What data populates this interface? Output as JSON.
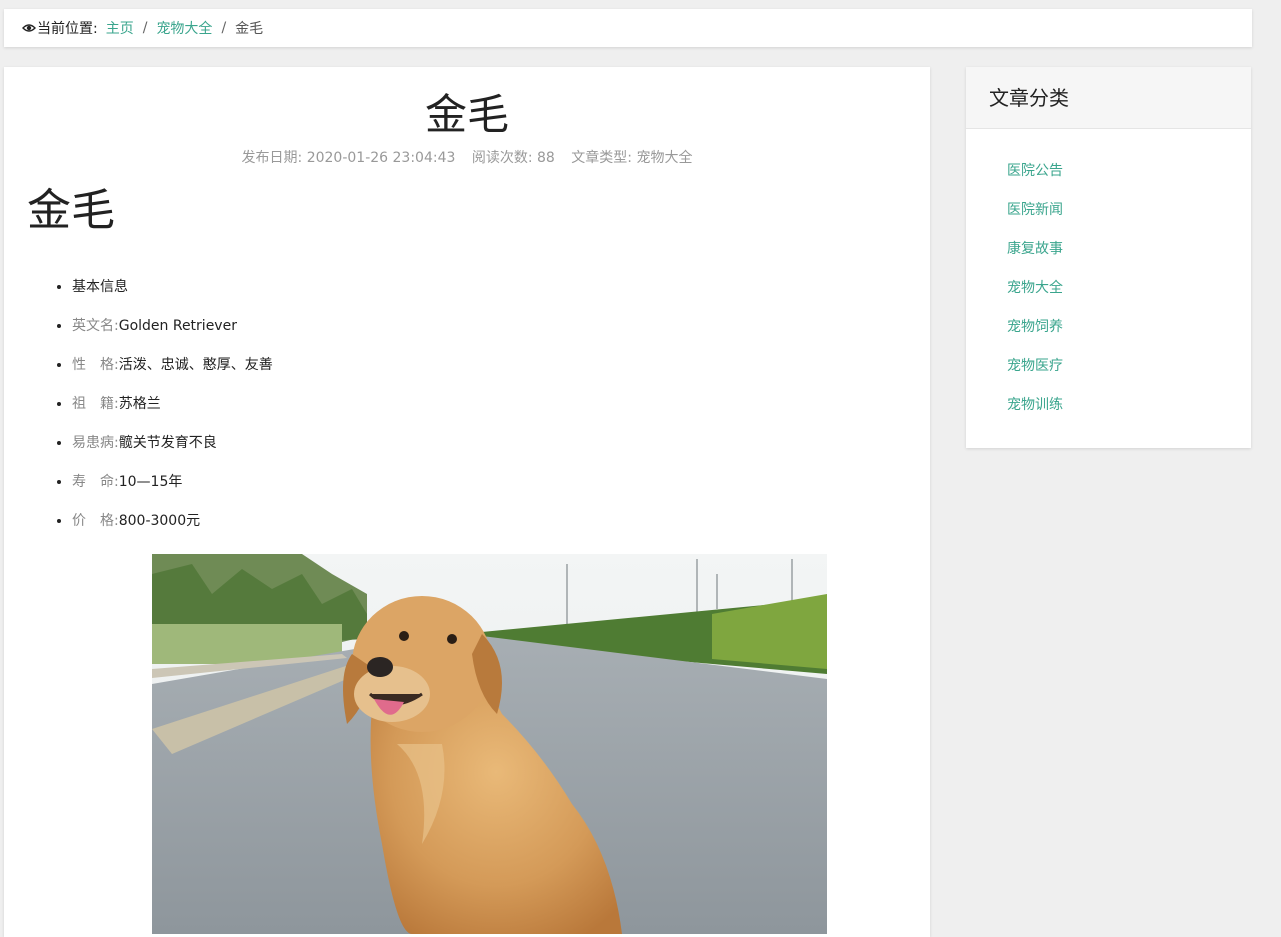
{
  "breadcrumb": {
    "label": "当前位置:",
    "items": [
      {
        "text": "主页"
      },
      {
        "text": "宠物大全"
      }
    ],
    "separator": "/",
    "current": "金毛"
  },
  "article": {
    "title": "金毛",
    "meta": {
      "date": "发布日期: 2020-01-26 23:04:43",
      "views": "阅读次数: 88",
      "type": "文章类型: 宠物大全"
    },
    "content_title": "金毛",
    "info": [
      {
        "key": "",
        "value": "基本信息"
      },
      {
        "key": "英文名:",
        "value": "Golden Retriever"
      },
      {
        "key": "性　格:",
        "value": "活泼、忠诚、憨厚、友善"
      },
      {
        "key": "祖　籍:",
        "value": "苏格兰"
      },
      {
        "key": "易患病:",
        "value": "髋关节发育不良"
      },
      {
        "key": "寿　命:",
        "value": "10—15年"
      },
      {
        "key": "价　格:",
        "value": "800-3000元"
      }
    ]
  },
  "sidebar": {
    "title": "文章分类",
    "items": [
      {
        "label": "医院公告"
      },
      {
        "label": "医院新闻"
      },
      {
        "label": "康复故事"
      },
      {
        "label": "宠物大全"
      },
      {
        "label": "宠物饲养"
      },
      {
        "label": "宠物医疗"
      },
      {
        "label": "宠物训练"
      }
    ]
  },
  "colors": {
    "accent": "#3aa58d",
    "background": "#efefef"
  }
}
